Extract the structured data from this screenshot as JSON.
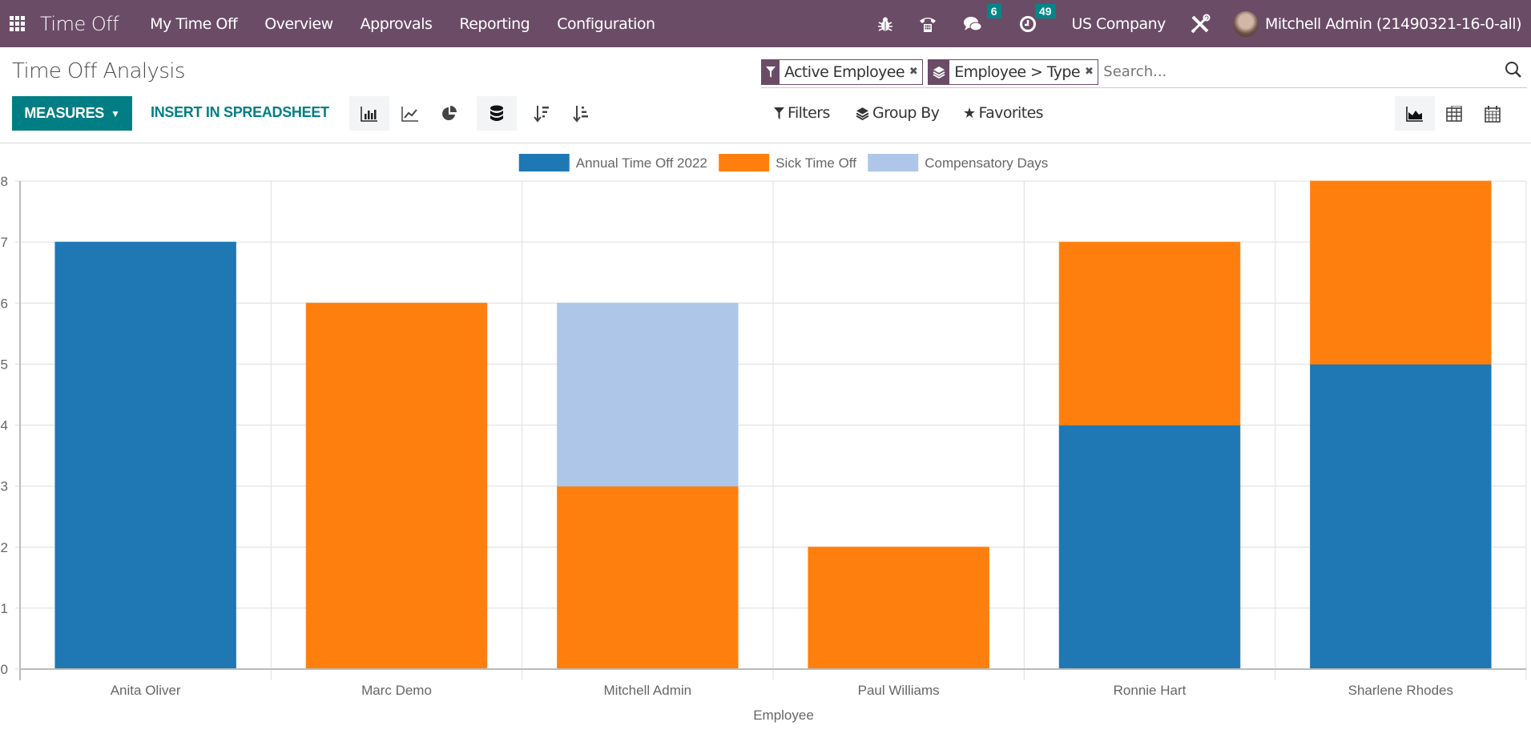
{
  "navbar": {
    "app_name": "Time Off",
    "menu": [
      "My Time Off",
      "Overview",
      "Approvals",
      "Reporting",
      "Configuration"
    ],
    "messages_count": "6",
    "activities_count": "49",
    "company": "US Company",
    "user": "Mitchell Admin (21490321-16-0-all)"
  },
  "page": {
    "title": "Time Off Analysis",
    "measures_label": "MEASURES",
    "insert_label": "INSERT IN SPREADSHEET"
  },
  "search": {
    "facets": [
      {
        "icon": "filter-icon",
        "label": "Active Employee"
      },
      {
        "icon": "layers-icon",
        "label": "Employee > Type"
      }
    ],
    "placeholder": "Search..."
  },
  "filters": {
    "filters_label": "Filters",
    "groupby_label": "Group By",
    "favorites_label": "Favorites"
  },
  "colors": {
    "brand": "#6b4c67",
    "accent": "#017e84",
    "annual": "#1f77b4",
    "sick": "#ff7f0e",
    "compensatory": "#aec7e8"
  },
  "chart_data": {
    "type": "bar",
    "stacked": true,
    "title": "",
    "xlabel": "Employee",
    "ylabel": "",
    "categories": [
      "Anita Oliver",
      "Marc Demo",
      "Mitchell Admin",
      "Paul Williams",
      "Ronnie Hart",
      "Sharlene Rhodes"
    ],
    "series": [
      {
        "name": "Annual Time Off 2022",
        "color": "#1f77b4",
        "values": [
          7,
          0,
          0,
          0,
          4,
          5
        ]
      },
      {
        "name": "Sick Time Off",
        "color": "#ff7f0e",
        "values": [
          0,
          6,
          3,
          2,
          3,
          3
        ]
      },
      {
        "name": "Compensatory Days",
        "color": "#aec7e8",
        "values": [
          0,
          0,
          3,
          0,
          0,
          0
        ]
      }
    ],
    "ylim": [
      0,
      8
    ],
    "yticks": [
      0,
      1,
      2,
      3,
      4,
      5,
      6,
      7,
      8
    ],
    "grid": true,
    "legend": "top-center"
  }
}
